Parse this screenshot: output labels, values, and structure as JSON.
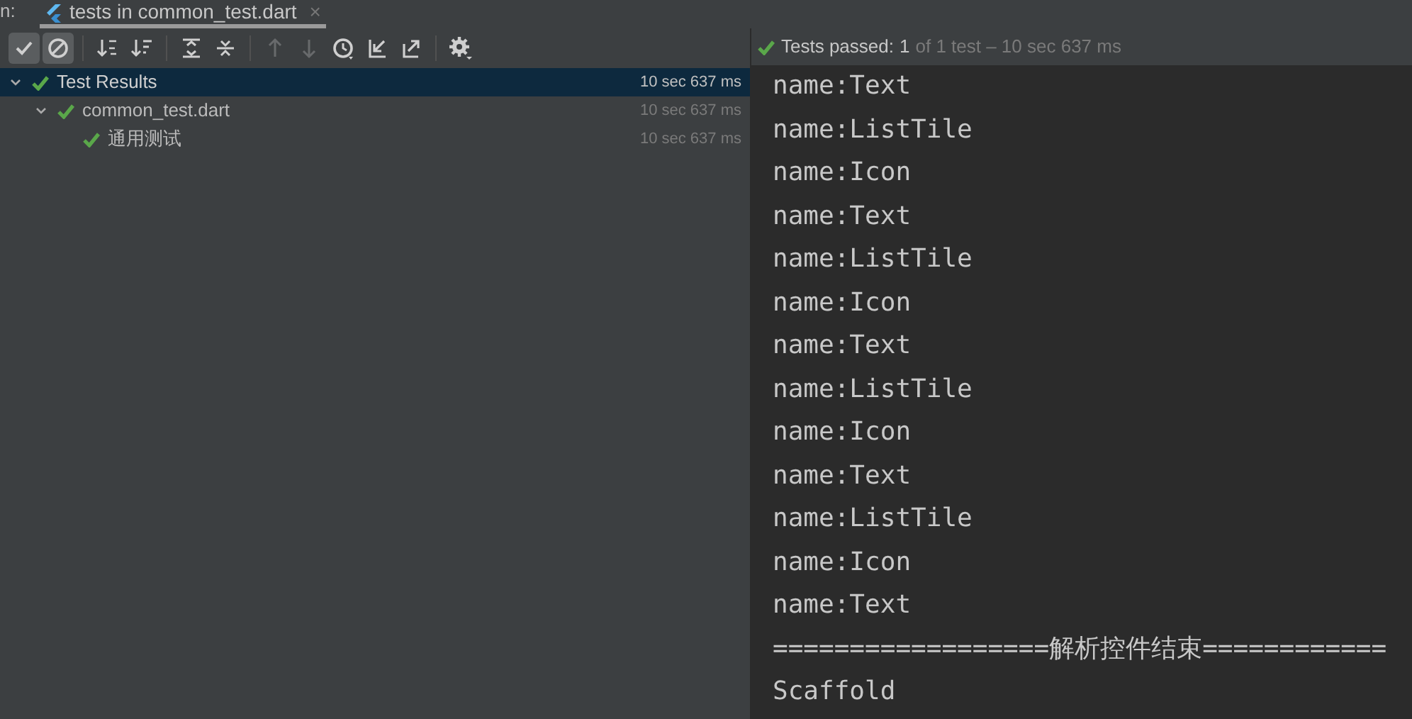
{
  "tab_bar": {
    "prefix": "n:",
    "tabs": [
      {
        "label": "tests in common_test.dart",
        "selected": true,
        "close": "×"
      }
    ]
  },
  "toolbar": [
    {
      "kind": "check",
      "selected": true,
      "disabled": false
    },
    {
      "kind": "ban",
      "selected": true,
      "disabled": false
    },
    {
      "kind": "sep"
    },
    {
      "kind": "sort-alpha",
      "selected": false,
      "disabled": false
    },
    {
      "kind": "sort-duration",
      "selected": false,
      "disabled": false
    },
    {
      "kind": "sep"
    },
    {
      "kind": "expand",
      "selected": false,
      "disabled": false
    },
    {
      "kind": "collapse",
      "selected": false,
      "disabled": false
    },
    {
      "kind": "sep"
    },
    {
      "kind": "up",
      "selected": false,
      "disabled": true
    },
    {
      "kind": "down",
      "selected": false,
      "disabled": true
    },
    {
      "kind": "history",
      "selected": false,
      "disabled": false
    },
    {
      "kind": "import",
      "selected": false,
      "disabled": false
    },
    {
      "kind": "export",
      "selected": false,
      "disabled": false
    },
    {
      "kind": "sep"
    },
    {
      "kind": "settings",
      "selected": false,
      "disabled": false
    }
  ],
  "tree": [
    {
      "label": "Test Results",
      "time": "10 sec 637 ms",
      "passed": true,
      "selected": true,
      "expanded": true,
      "children": [
        {
          "label": "common_test.dart",
          "time": "10 sec 637 ms",
          "passed": true,
          "selected": false,
          "expanded": true,
          "children": [
            {
              "label": "通用测试",
              "time": "10 sec 637 ms",
              "passed": true,
              "selected": false
            }
          ]
        }
      ]
    }
  ],
  "status": {
    "passed": true,
    "label": "Tests passed:",
    "count": "1",
    "detail": "of 1 test – 10 sec 637 ms"
  },
  "console": [
    "name:Text",
    "name:ListTile",
    "name:Icon",
    "name:Text",
    "name:ListTile",
    "name:Icon",
    "name:Text",
    "name:ListTile",
    "name:Icon",
    "name:Text",
    "name:ListTile",
    "name:Icon",
    "name:Text",
    "==================解析控件结束============",
    "Scaffold"
  ]
}
